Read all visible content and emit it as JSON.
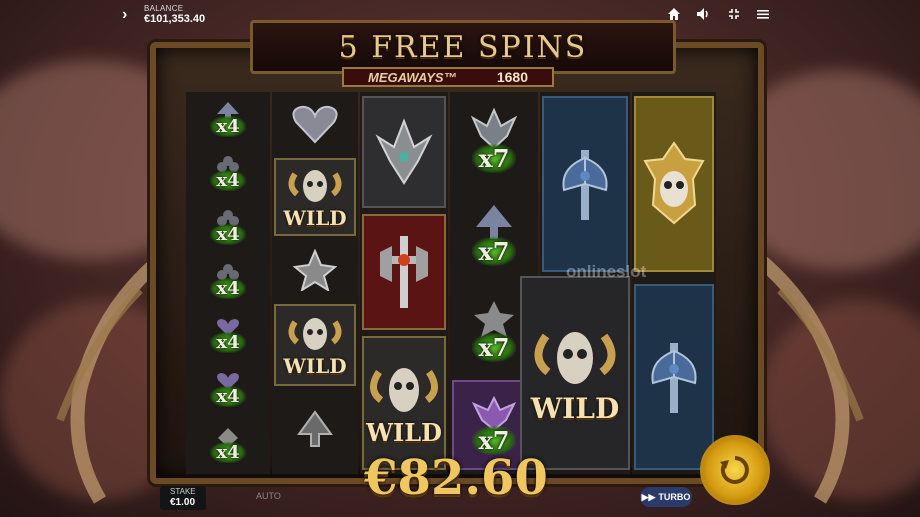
{
  "header": {
    "balance_label": "BALANCE",
    "balance_value": "€101,353.40",
    "icons": [
      "chevron-right-icon",
      "home-icon",
      "sound-icon",
      "fullscreen-icon",
      "hamburger-menu-icon"
    ]
  },
  "banner": {
    "title": "5 FREE SPINS",
    "megaways_label": "MEGAWAYS™",
    "megaways_value": "1680"
  },
  "reels": [
    {
      "name": "reel-1",
      "cells": [
        {
          "symbol": "spade-low-icon",
          "mult": "x4"
        },
        {
          "symbol": "club-low-icon",
          "mult": "x4"
        },
        {
          "symbol": "club-low-icon",
          "mult": "x4"
        },
        {
          "symbol": "club-low-icon",
          "mult": "x4"
        },
        {
          "symbol": "heart-low-icon",
          "mult": "x4"
        },
        {
          "symbol": "heart-low-icon",
          "mult": "x4"
        },
        {
          "symbol": "diamond-low-icon",
          "mult": "x4"
        }
      ]
    },
    {
      "name": "reel-2",
      "cells": [
        {
          "symbol": "heart-icon",
          "mult": ""
        },
        {
          "symbol": "ram-skull-wild-icon",
          "wild": "WILD"
        },
        {
          "symbol": "star-icon",
          "mult": ""
        },
        {
          "symbol": "ram-skull-wild-icon",
          "wild": "WILD"
        },
        {
          "symbol": "spade-icon",
          "mult": ""
        }
      ]
    },
    {
      "name": "reel-3",
      "cells": [
        {
          "symbol": "axes-shield-icon",
          "mult": ""
        },
        {
          "symbol": "crossed-swords-shield-icon",
          "mult": ""
        },
        {
          "symbol": "ram-skull-wild-icon",
          "wild": "WILD"
        }
      ]
    },
    {
      "name": "reel-4",
      "cells": [
        {
          "symbol": "axes-low-icon",
          "mult": "x7"
        },
        {
          "symbol": "spade-low-icon",
          "mult": "x7"
        },
        {
          "symbol": "star-low-icon",
          "mult": "x7"
        },
        {
          "symbol": "axes-purple-icon",
          "mult": "x7"
        }
      ]
    },
    {
      "name": "reel-5",
      "cells": [
        {
          "symbol": "blue-axe-banner-icon",
          "mult": ""
        },
        {
          "symbol": "ram-skull-wild-icon",
          "wild": "WILD"
        }
      ]
    },
    {
      "name": "reel-6",
      "cells": [
        {
          "symbol": "golden-demon-skull-icon",
          "mult": ""
        },
        {
          "symbol": "blue-axe-banner-icon",
          "mult": ""
        }
      ]
    }
  ],
  "win": {
    "amount": "€82.60"
  },
  "controls": {
    "stake_label": "STAKE",
    "stake_value": "€1.00",
    "auto_label": "AUTO",
    "turbo_label": "TURBO"
  },
  "watermark": "onlineslot",
  "colors": {
    "gold": "#f0c660",
    "multiplier_glow": "#5cbf2a",
    "frame": "#6b4a24",
    "banner_red": "#3a0c0c"
  }
}
